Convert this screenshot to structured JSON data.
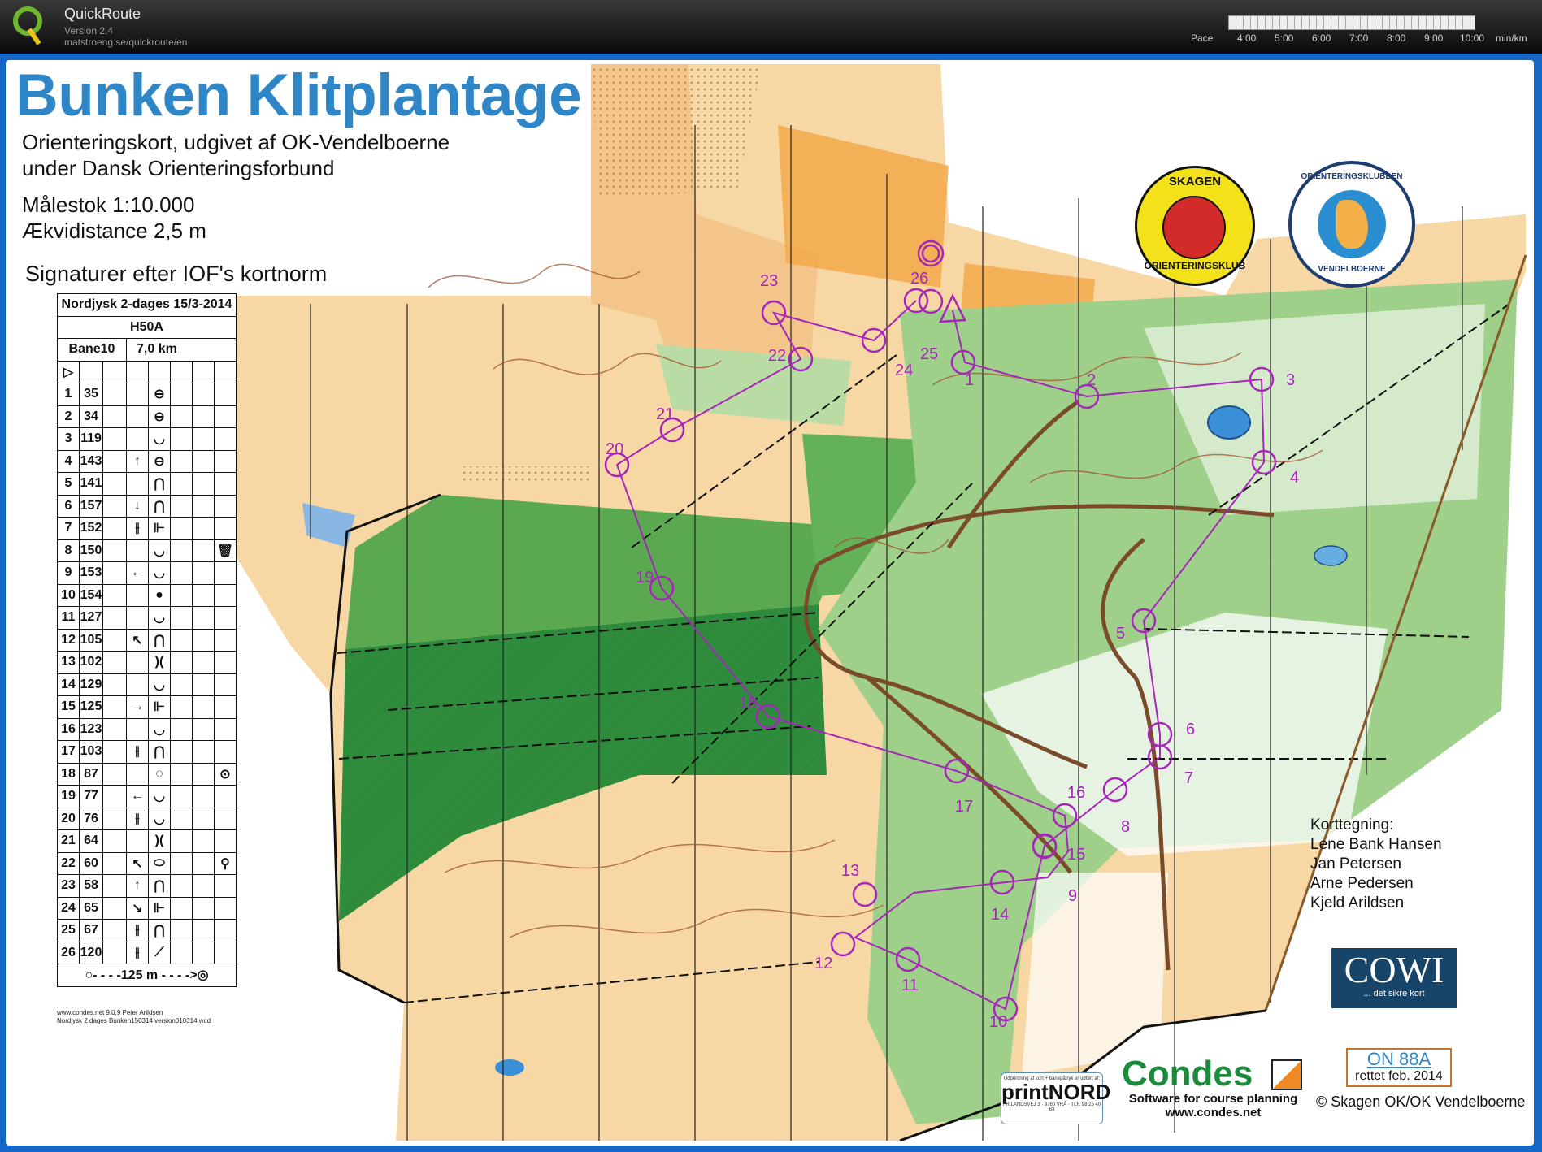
{
  "app": {
    "name": "QuickRoute",
    "version": "Version 2.4",
    "url": "matstroeng.se/quickroute/en"
  },
  "pace_scale": {
    "label": "Pace",
    "ticks": [
      "4:00",
      "5:00",
      "6:00",
      "7:00",
      "8:00",
      "9:00",
      "10:00"
    ],
    "unit": "min/km"
  },
  "map": {
    "title": "Bunken Klitplantage",
    "info_line1": "Orienteringskort, udgivet af OK-Vendelboerne",
    "info_line2": "under Dansk Orienteringsforbund",
    "scale": "Målestok 1:10.000",
    "contour": "Ækvidistance 2,5 m",
    "signatures_heading": "Signaturer efter IOF's kortnorm",
    "credits_heading": "Korttegning:",
    "credits": [
      "Lene Bank Hansen",
      "Jan Petersen",
      "Arne Pedersen",
      "Kjeld Arildsen"
    ],
    "cowi": {
      "name": "COWI",
      "tagline": "... det sikre kort"
    },
    "on_code": "ON 88A",
    "on_date": "rettet feb. 2014",
    "copyright": "© Skagen OK/OK Vendelboerne",
    "condes": {
      "name": "Condes",
      "tagline": "Software for course planning",
      "url": "www.condes.net"
    },
    "printnord": {
      "small": "Udprintning af kort + banepåtryk er udført af:",
      "name": "printNORD",
      "address": "FRILANDSVEJ 3 · 9760 VRÅ · TLF. 98 25 40 83"
    },
    "club_badges": {
      "skagen": {
        "top": "SKAGEN",
        "bottom": "ORIENTERINGSKLUB"
      },
      "vendelboerne": {
        "top": "ORIENTERINGSKLUBBEN",
        "bottom": "VENDELBOERNE"
      }
    },
    "footer_notes": [
      "www.condes.net 9.0.9 Peter Arildsen",
      "Nordjysk 2 dages Bunken150314 version010314.wcd"
    ]
  },
  "course": {
    "event": "Nordjysk 2-dages 15/3-2014",
    "class": "H50A",
    "course_name": "Bane10",
    "length": "7,0 km",
    "controls": [
      {
        "n": "1",
        "code": "35",
        "dir": "",
        "feat": "⊖",
        "extra": ""
      },
      {
        "n": "2",
        "code": "34",
        "dir": "",
        "feat": "⊖",
        "extra": ""
      },
      {
        "n": "3",
        "code": "119",
        "dir": "",
        "feat": "◡",
        "extra": ""
      },
      {
        "n": "4",
        "code": "143",
        "dir": "↑",
        "feat": "⊖",
        "extra": ""
      },
      {
        "n": "5",
        "code": "141",
        "dir": "",
        "feat": "⋂",
        "extra": ""
      },
      {
        "n": "6",
        "code": "157",
        "dir": "↓",
        "feat": "⋂",
        "extra": ""
      },
      {
        "n": "7",
        "code": "152",
        "dir": "⫲",
        "feat": "⊩",
        "extra": ""
      },
      {
        "n": "8",
        "code": "150",
        "dir": "",
        "feat": "◡",
        "extra": "🗑"
      },
      {
        "n": "9",
        "code": "153",
        "dir": "←",
        "feat": "◡",
        "extra": ""
      },
      {
        "n": "10",
        "code": "154",
        "dir": "",
        "feat": "●",
        "extra": ""
      },
      {
        "n": "11",
        "code": "127",
        "dir": "",
        "feat": "◡",
        "extra": ""
      },
      {
        "n": "12",
        "code": "105",
        "dir": "↖",
        "feat": "⋂",
        "extra": ""
      },
      {
        "n": "13",
        "code": "102",
        "dir": "",
        "feat": ")(",
        "extra": ""
      },
      {
        "n": "14",
        "code": "129",
        "dir": "",
        "feat": "◡",
        "extra": ""
      },
      {
        "n": "15",
        "code": "125",
        "dir": "→",
        "feat": "⊩",
        "extra": ""
      },
      {
        "n": "16",
        "code": "123",
        "dir": "",
        "feat": "◡",
        "extra": ""
      },
      {
        "n": "17",
        "code": "103",
        "dir": "⫲",
        "feat": "⋂",
        "extra": ""
      },
      {
        "n": "18",
        "code": "87",
        "dir": "",
        "feat": "◌",
        "extra": "⊙"
      },
      {
        "n": "19",
        "code": "77",
        "dir": "←",
        "feat": "◡",
        "extra": ""
      },
      {
        "n": "20",
        "code": "76",
        "dir": "⫲",
        "feat": "◡",
        "extra": ""
      },
      {
        "n": "21",
        "code": "64",
        "dir": "",
        "feat": ")(",
        "extra": ""
      },
      {
        "n": "22",
        "code": "60",
        "dir": "↖",
        "feat": "⬭",
        "extra": "⚲"
      },
      {
        "n": "23",
        "code": "58",
        "dir": "↑",
        "feat": "⋂",
        "extra": ""
      },
      {
        "n": "24",
        "code": "65",
        "dir": "↘",
        "feat": "⊩",
        "extra": ""
      },
      {
        "n": "25",
        "code": "67",
        "dir": "⫲",
        "feat": "⋂",
        "extra": ""
      },
      {
        "n": "26",
        "code": "120",
        "dir": "⫲",
        "feat": "⟋",
        "extra": ""
      }
    ],
    "finish_line": "○- - - -125 m - - - ->◎",
    "map_controls": [
      {
        "label": "1"
      },
      {
        "label": "2"
      },
      {
        "label": "3"
      },
      {
        "label": "4"
      },
      {
        "label": "5"
      },
      {
        "label": "6"
      },
      {
        "label": "7"
      },
      {
        "label": "8"
      },
      {
        "label": "9"
      },
      {
        "label": "10"
      },
      {
        "label": "11"
      },
      {
        "label": "12"
      },
      {
        "label": "13"
      },
      {
        "label": "14"
      },
      {
        "label": "15"
      },
      {
        "label": "16"
      },
      {
        "label": "17"
      },
      {
        "label": "18"
      },
      {
        "label": "19"
      },
      {
        "label": "20"
      },
      {
        "label": "21"
      },
      {
        "label": "22"
      },
      {
        "label": "23"
      },
      {
        "label": "24"
      },
      {
        "label": "25"
      },
      {
        "label": "26"
      }
    ]
  },
  "colors": {
    "title": "#2f86c6",
    "course": "#a526b8",
    "forest_dark": "#2e8b3c",
    "forest_light": "#8cc47a",
    "open_land": "#f7c98b",
    "frame": "#1668c8"
  }
}
